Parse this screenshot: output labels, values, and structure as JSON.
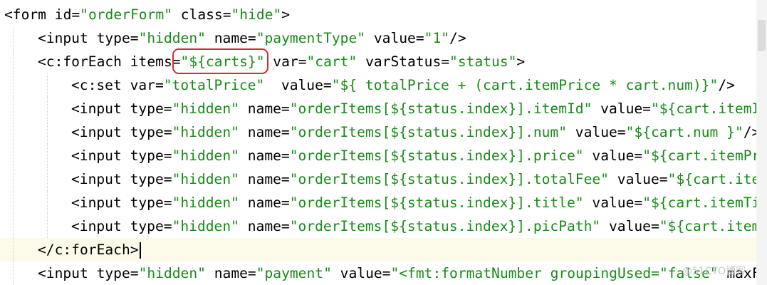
{
  "colors": {
    "tag": "#000000",
    "attr_value": "#188b18",
    "background": "#ffffff",
    "current_line": "#fcfbea",
    "highlight_box": "#d62c2c"
  },
  "code_lines": [
    {
      "tokens": [
        {
          "t": "<form id=",
          "c": "tag"
        },
        {
          "t": "\"orderForm\"",
          "c": "val"
        },
        {
          "t": " class=",
          "c": "tag"
        },
        {
          "t": "\"hide\"",
          "c": "val"
        },
        {
          "t": ">",
          "c": "tag"
        }
      ]
    },
    {
      "tokens": [
        {
          "t": "<input type=",
          "c": "tag"
        },
        {
          "t": "\"hidden\"",
          "c": "val"
        },
        {
          "t": " name=",
          "c": "tag"
        },
        {
          "t": "\"paymentType\"",
          "c": "val"
        },
        {
          "t": " value=",
          "c": "tag"
        },
        {
          "t": "\"1\"",
          "c": "val"
        },
        {
          "t": "/>",
          "c": "tag"
        }
      ]
    },
    {
      "tokens": [
        {
          "t": "<c:forEach items=",
          "c": "tag"
        },
        {
          "t": "\"${carts}\"",
          "c": "val"
        },
        {
          "t": " var=",
          "c": "tag"
        },
        {
          "t": "\"cart\"",
          "c": "val"
        },
        {
          "t": " varStatus=",
          "c": "tag"
        },
        {
          "t": "\"status\"",
          "c": "val"
        },
        {
          "t": ">",
          "c": "tag"
        }
      ]
    },
    {
      "tokens": [
        {
          "t": "<c:set var=",
          "c": "tag"
        },
        {
          "t": "\"totalPrice\"",
          "c": "val"
        },
        {
          "t": "  value=",
          "c": "tag"
        },
        {
          "t": "\"${ totalPrice + (cart.itemPrice * cart.num)}\"",
          "c": "val"
        },
        {
          "t": "/>",
          "c": "tag"
        }
      ]
    },
    {
      "tokens": [
        {
          "t": "<input type=",
          "c": "tag"
        },
        {
          "t": "\"hidden\"",
          "c": "val"
        },
        {
          "t": " name=",
          "c": "tag"
        },
        {
          "t": "\"orderItems[${status.index}].itemId\"",
          "c": "val"
        },
        {
          "t": " value=",
          "c": "tag"
        },
        {
          "t": "\"${cart.itemId}\"",
          "c": "val"
        },
        {
          "t": "/>",
          "c": "tag"
        }
      ]
    },
    {
      "tokens": [
        {
          "t": "<input type=",
          "c": "tag"
        },
        {
          "t": "\"hidden\"",
          "c": "val"
        },
        {
          "t": " name=",
          "c": "tag"
        },
        {
          "t": "\"orderItems[${status.index}].num\"",
          "c": "val"
        },
        {
          "t": " value=",
          "c": "tag"
        },
        {
          "t": "\"${cart.num }\"",
          "c": "val"
        },
        {
          "t": "/>",
          "c": "tag"
        }
      ]
    },
    {
      "tokens": [
        {
          "t": "<input type=",
          "c": "tag"
        },
        {
          "t": "\"hidden\"",
          "c": "val"
        },
        {
          "t": " name=",
          "c": "tag"
        },
        {
          "t": "\"orderItems[${status.index}].price\"",
          "c": "val"
        },
        {
          "t": " value=",
          "c": "tag"
        },
        {
          "t": "\"${cart.itemPrice}\"",
          "c": "val"
        },
        {
          "t": "/>",
          "c": "tag"
        }
      ]
    },
    {
      "tokens": [
        {
          "t": "<input type=",
          "c": "tag"
        },
        {
          "t": "\"hidden\"",
          "c": "val"
        },
        {
          "t": " name=",
          "c": "tag"
        },
        {
          "t": "\"orderItems[${status.index}].totalFee\"",
          "c": "val"
        },
        {
          "t": " value=",
          "c": "tag"
        },
        {
          "t": "\"${cart.itemPrice}\"",
          "c": "val"
        },
        {
          "t": "/>",
          "c": "tag"
        }
      ]
    },
    {
      "tokens": [
        {
          "t": "<input type=",
          "c": "tag"
        },
        {
          "t": "\"hidden\"",
          "c": "val"
        },
        {
          "t": " name=",
          "c": "tag"
        },
        {
          "t": "\"orderItems[${status.index}].title\"",
          "c": "val"
        },
        {
          "t": " value=",
          "c": "tag"
        },
        {
          "t": "\"${cart.itemTitle}\"",
          "c": "val"
        },
        {
          "t": "/>",
          "c": "tag"
        }
      ]
    },
    {
      "tokens": [
        {
          "t": "<input type=",
          "c": "tag"
        },
        {
          "t": "\"hidden\"",
          "c": "val"
        },
        {
          "t": " name=",
          "c": "tag"
        },
        {
          "t": "\"orderItems[${status.index}].picPath\"",
          "c": "val"
        },
        {
          "t": " value=",
          "c": "tag"
        },
        {
          "t": "\"${cart.itemImage}\"",
          "c": "val"
        },
        {
          "t": "/>",
          "c": "tag"
        }
      ]
    },
    {
      "tokens": [
        {
          "t": "</c:forEach>",
          "c": "tag"
        }
      ]
    },
    {
      "tokens": [
        {
          "t": "<input type=",
          "c": "tag"
        },
        {
          "t": "\"hidden\"",
          "c": "val"
        },
        {
          "t": " name=",
          "c": "tag"
        },
        {
          "t": "\"payment\"",
          "c": "val"
        },
        {
          "t": " value=",
          "c": "tag"
        },
        {
          "t": "\"<fmt:formatNumber groupingUsed=",
          "c": "val"
        },
        {
          "t": "\"false\"",
          "c": "val"
        },
        {
          "t": " maxFractionDigits=",
          "c": "tag"
        }
      ]
    }
  ],
  "watermark": "@51CTO博客"
}
